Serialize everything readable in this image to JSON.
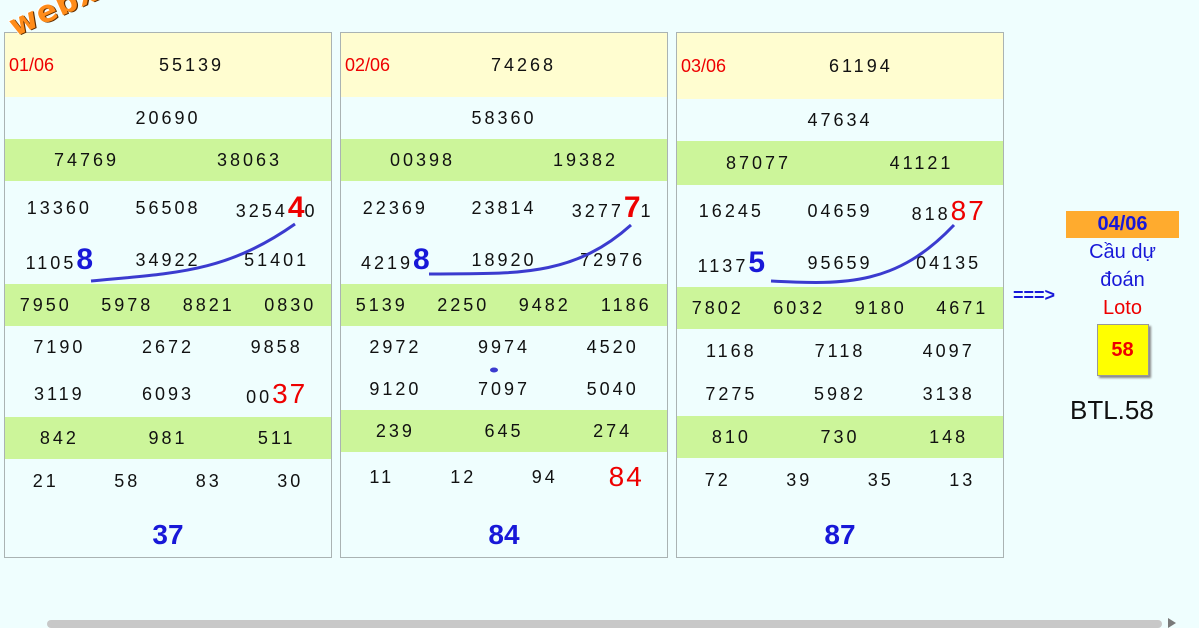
{
  "watermark": "webxoso.net",
  "panels": [
    {
      "date": "01/06",
      "db": "55139",
      "g1": "20690",
      "g2": [
        "74769",
        "38063"
      ],
      "g3a": [
        "13360",
        "56508",
        "3254",
        "4",
        "0"
      ],
      "g3b": [
        "1105",
        "8",
        "34922",
        "51401"
      ],
      "g4": [
        "7950",
        "5978",
        "8821",
        "0830"
      ],
      "g5a": [
        "7190",
        "2672",
        "9858"
      ],
      "g5b": [
        "3119",
        "6093",
        "00",
        "37"
      ],
      "g6": [
        "842",
        "981",
        "511"
      ],
      "g7": [
        "21",
        "58",
        "83",
        "30"
      ],
      "result": "37"
    },
    {
      "date": "02/06",
      "db": "74268",
      "g1": "58360",
      "g2": [
        "00398",
        "19382"
      ],
      "g3a": [
        "22369",
        "23814",
        "3277",
        "7",
        "1"
      ],
      "g3b": [
        "4219",
        "8",
        "18920",
        "72976"
      ],
      "g4": [
        "5139",
        "2250",
        "9482",
        "1186"
      ],
      "g5a": [
        "2972",
        "9974",
        "4520"
      ],
      "g5b": [
        "9120",
        "7097",
        "5040"
      ],
      "g6": [
        "239",
        "645",
        "274"
      ],
      "g7": [
        "11",
        "12",
        "94",
        "84"
      ],
      "result": "84"
    },
    {
      "date": "03/06",
      "db": "61194",
      "g1": "47634",
      "g2": [
        "87077",
        "41121"
      ],
      "g3a": [
        "16245",
        "04659",
        "818",
        "87",
        ""
      ],
      "g3b": [
        "1137",
        "5",
        "95659",
        "04135"
      ],
      "g4": [
        "7802",
        "6032",
        "9180",
        "4671"
      ],
      "g5a": [
        "1168",
        "7118",
        "4097"
      ],
      "g5b": [
        "7275",
        "5982",
        "3138"
      ],
      "g6": [
        "810",
        "730",
        "148"
      ],
      "g7": [
        "72",
        "39",
        "35",
        "13"
      ],
      "result": "87"
    }
  ],
  "arrow": "===>",
  "prediction": {
    "date": "04/06",
    "line1": "Cầu dự",
    "line2": "đoán",
    "line3": "Loto",
    "value": "58"
  },
  "btl": "BTL.58",
  "colors": {
    "red": "#ee0000",
    "blue": "#1818d8",
    "green_row": "#ccf59a",
    "yellow_row": "#fffdd0"
  }
}
